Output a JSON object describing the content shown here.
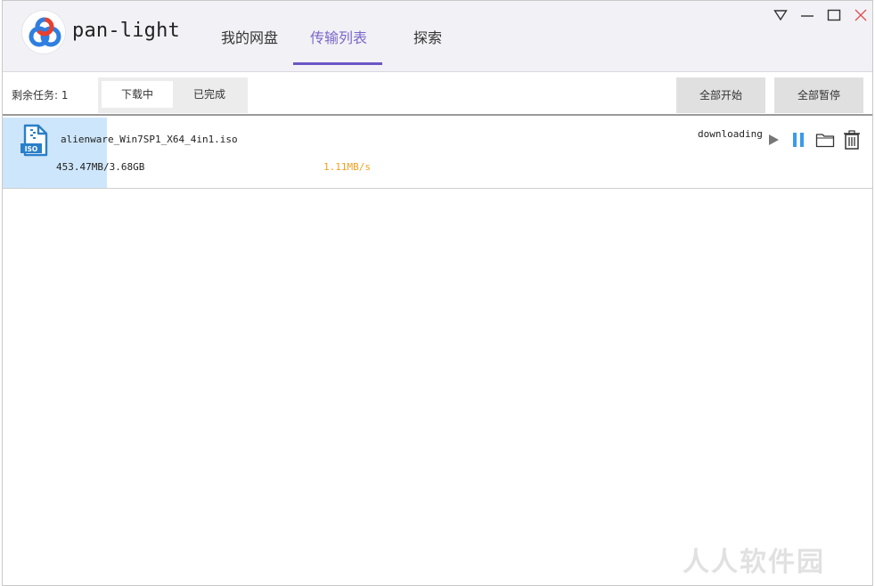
{
  "app": {
    "title": "pan-light"
  },
  "tabs": [
    {
      "label": "我的网盘",
      "active": false
    },
    {
      "label": "传输列表",
      "active": true
    },
    {
      "label": "探索",
      "active": false
    }
  ],
  "window_controls": [
    "dropdown-triangle-icon",
    "minimize-icon",
    "maximize-icon",
    "close-icon"
  ],
  "toolbar": {
    "remaining_label": "剩余任务: 1",
    "filters": [
      {
        "label": "下载中",
        "active": true
      },
      {
        "label": "已完成",
        "active": false
      }
    ],
    "start_all_label": "全部开始",
    "pause_all_label": "全部暂停"
  },
  "tasks": [
    {
      "file_icon": "iso-file-icon",
      "file_name": "alienware_Win7SP1_X64_4in1.iso",
      "size_progress": "453.47MB/3.68GB",
      "speed": "1.11MB/s",
      "status": "downloading",
      "progress_fraction": 0.12,
      "actions": [
        "play-icon",
        "pause-icon",
        "folder-icon",
        "trash-icon"
      ]
    }
  ],
  "watermark": "人人软件园",
  "colors": {
    "accent": "#6c56c4",
    "progress": "#cde6fb",
    "speed": "#f0a020",
    "pause_icon": "#3b9be6"
  }
}
